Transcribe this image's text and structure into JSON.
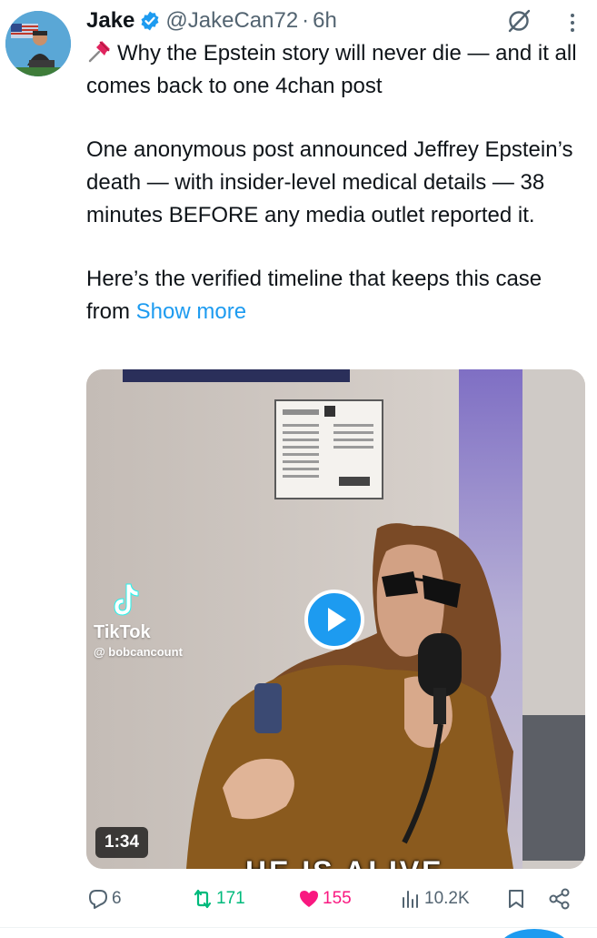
{
  "tweet": {
    "author": {
      "display_name": "Jake",
      "handle": "@JakeCan72",
      "verified": true,
      "avatar": "avatar-image"
    },
    "timestamp": "6h",
    "separator": "·",
    "text": {
      "line1": "Why the Epstein story will never die — and it all comes back to one 4chan post",
      "paragraph2": "One anonymous post announced Jeffrey Epstein’s death — with insider-level medical details — 38 minutes BEFORE any media outlet reported it.",
      "paragraph3": "Here’s the verified timeline that keeps this case from",
      "show_more": "Show more"
    },
    "media": {
      "type": "video",
      "duration": "1:34",
      "watermark_app": "TikTok",
      "watermark_user": "@ bobcancount",
      "caption_partial": "HE IS ALIVE"
    },
    "actions": {
      "replies": "6",
      "reposts": "171",
      "likes": "155",
      "views": "10.2K"
    }
  },
  "colors": {
    "accent": "#1d9bf0",
    "repost": "#00ba7c",
    "like": "#f91880",
    "muted": "#536471",
    "text": "#0f1419"
  },
  "icons": [
    "verified-badge-icon",
    "grok-icon",
    "more-icon",
    "pushpin-icon",
    "play-icon",
    "tiktok-logo-icon",
    "reply-icon",
    "repost-icon",
    "like-icon",
    "views-icon",
    "bookmark-icon",
    "share-icon"
  ]
}
